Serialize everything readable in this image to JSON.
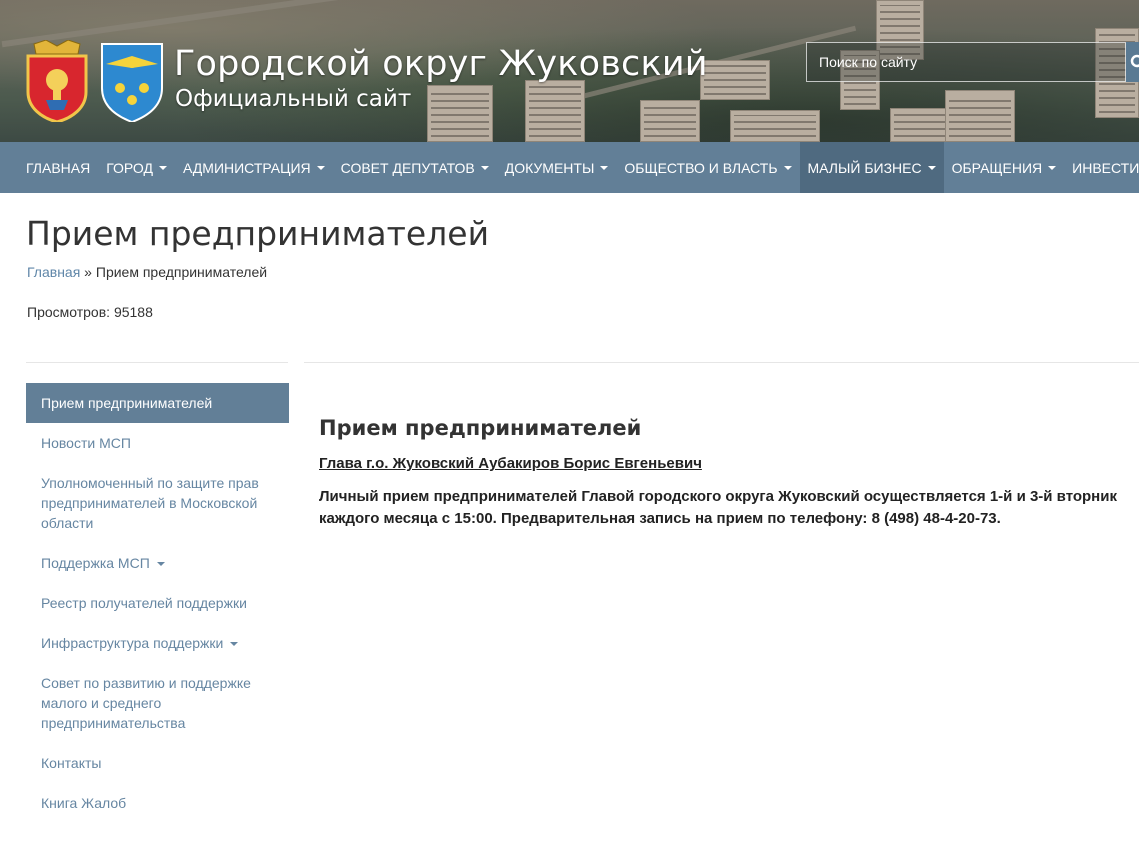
{
  "header": {
    "site_title": "Городской округ Жуковский",
    "site_subtitle": "Официальный сайт",
    "search_placeholder": "Поиск по сайту"
  },
  "nav": {
    "items": [
      {
        "label": "ГЛАВНАЯ",
        "dropdown": false
      },
      {
        "label": "ГОРОД",
        "dropdown": true
      },
      {
        "label": "АДМИНИСТРАЦИЯ",
        "dropdown": true
      },
      {
        "label": "СОВЕТ ДЕПУТАТОВ",
        "dropdown": true
      },
      {
        "label": "ДОКУМЕНТЫ",
        "dropdown": true
      },
      {
        "label": "ОБЩЕСТВО И ВЛАСТЬ",
        "dropdown": true
      },
      {
        "label": "МАЛЫЙ БИЗНЕС",
        "dropdown": true,
        "active": true
      },
      {
        "label": "ОБРАЩЕНИЯ",
        "dropdown": true
      },
      {
        "label": "ИНВЕСТИЦИИ",
        "dropdown": true
      }
    ]
  },
  "page": {
    "title": "Прием предпринимателей",
    "breadcrumb_home": "Главная",
    "breadcrumb_sep": " » ",
    "breadcrumb_current": "Прием предпринимателей",
    "views": "Просмотров: 95188"
  },
  "sidebar": {
    "items": [
      {
        "label": "Прием предпринимателей",
        "active": true
      },
      {
        "label": "Новости МСП"
      },
      {
        "label": "Уполномоченный по защите прав предпринимателей в Московской области"
      },
      {
        "label": "Поддержка МСП",
        "dropdown": true
      },
      {
        "label": "Реестр получателей поддержки"
      },
      {
        "label": "Инфраструктура поддержки",
        "dropdown": true
      },
      {
        "label": "Совет по развитию и поддержке малого и среднего предпринимательства"
      },
      {
        "label": "Контакты"
      },
      {
        "label": "Книга Жалоб"
      }
    ]
  },
  "content": {
    "title": "Прием предпринимателей",
    "head_link": "Глава г.о. Жуковский Аубакиров Борис Евгеньевич",
    "text": "Личный прием предпринимателей Главой городского округа Жуковский осуществляется 1-й и 3-й вторник каждого месяца с 15:00. Предварительная запись на прием по телефону: 8 (498) 48-4-20-73."
  },
  "colors": {
    "nav_bg": "#627f97",
    "nav_active_bg": "#4f6a80",
    "link": "#6686a2"
  }
}
